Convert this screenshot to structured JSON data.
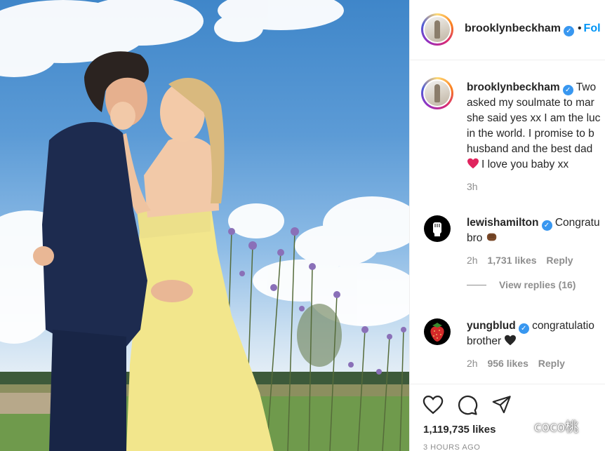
{
  "post": {
    "username": "brooklynbeckham",
    "follow_label": "Fol",
    "verified_icon": "✓",
    "caption_lines": [
      "Two",
      "asked my soulmate to mar",
      "she said yes xx I am the luc",
      "in the world. I promise to b",
      "husband and the best dad",
      "I love you baby xx"
    ],
    "caption_time": "3h"
  },
  "comments": [
    {
      "username": "lewishamilton",
      "text_line1": "Congratu",
      "text_line2": "bro",
      "time": "2h",
      "likes": "1,731 likes",
      "reply": "Reply",
      "view_replies": "View replies (16)"
    },
    {
      "username": "yungblud",
      "text_line1": "congratulatio",
      "text_line2": "brother",
      "time": "2h",
      "likes": "956 likes",
      "reply": "Reply"
    }
  ],
  "footer": {
    "likes": "1,119,735 likes",
    "time_ago": "3 HOURS AGO"
  },
  "watermark": "coco桃",
  "colors": {
    "accent": "#0095f6",
    "verified": "#3897f0",
    "muted": "#8e8e8e",
    "heart_red": "#e0245e"
  }
}
